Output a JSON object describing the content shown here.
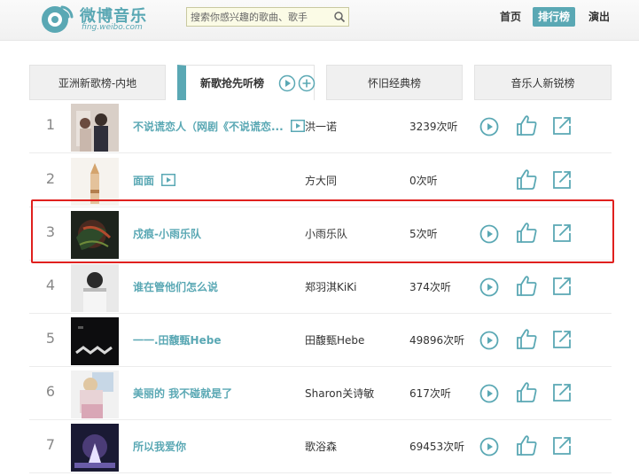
{
  "header": {
    "logo_title": "微博音乐",
    "logo_sub": "fing.weibo.com",
    "search_placeholder": "搜索你感兴趣的歌曲、歌手",
    "nav": {
      "home": "首页",
      "rank": "排行榜",
      "show": "演出"
    }
  },
  "tabs": [
    {
      "label": "亚洲新歌榜-内地"
    },
    {
      "label": "新歌抢先听榜"
    },
    {
      "label": "怀旧经典榜"
    },
    {
      "label": "音乐人新锐榜"
    }
  ],
  "rows": [
    {
      "rank": "1",
      "title": "不说谎恋人（网剧《不说谎恋...",
      "artist": "洪一诺",
      "plays": "3239次听",
      "has_mv": true,
      "has_play": true
    },
    {
      "rank": "2",
      "title": "面面",
      "artist": "方大同",
      "plays": "0次听",
      "has_mv": true,
      "has_play": false
    },
    {
      "rank": "3",
      "title": "戍痕-小雨乐队",
      "artist": "小雨乐队",
      "plays": "5次听",
      "has_mv": false,
      "has_play": true
    },
    {
      "rank": "4",
      "title": "谁在管他们怎么说",
      "artist": "郑羽淇KiKi",
      "plays": "374次听",
      "has_mv": false,
      "has_play": true
    },
    {
      "rank": "5",
      "title": "一一.田馥甄Hebe",
      "artist": "田馥甄Hebe",
      "plays": "49896次听",
      "has_mv": false,
      "has_play": true
    },
    {
      "rank": "6",
      "title": "美丽的 我不碰就是了",
      "artist": "Sharon关诗敏",
      "plays": "617次听",
      "has_mv": false,
      "has_play": true
    },
    {
      "rank": "7",
      "title": "所以我爱你",
      "artist": "歌浴森",
      "plays": "69453次听",
      "has_mv": false,
      "has_play": true
    }
  ],
  "colors": {
    "accent": "#5aa8b4",
    "highlight": "#e0201e"
  }
}
